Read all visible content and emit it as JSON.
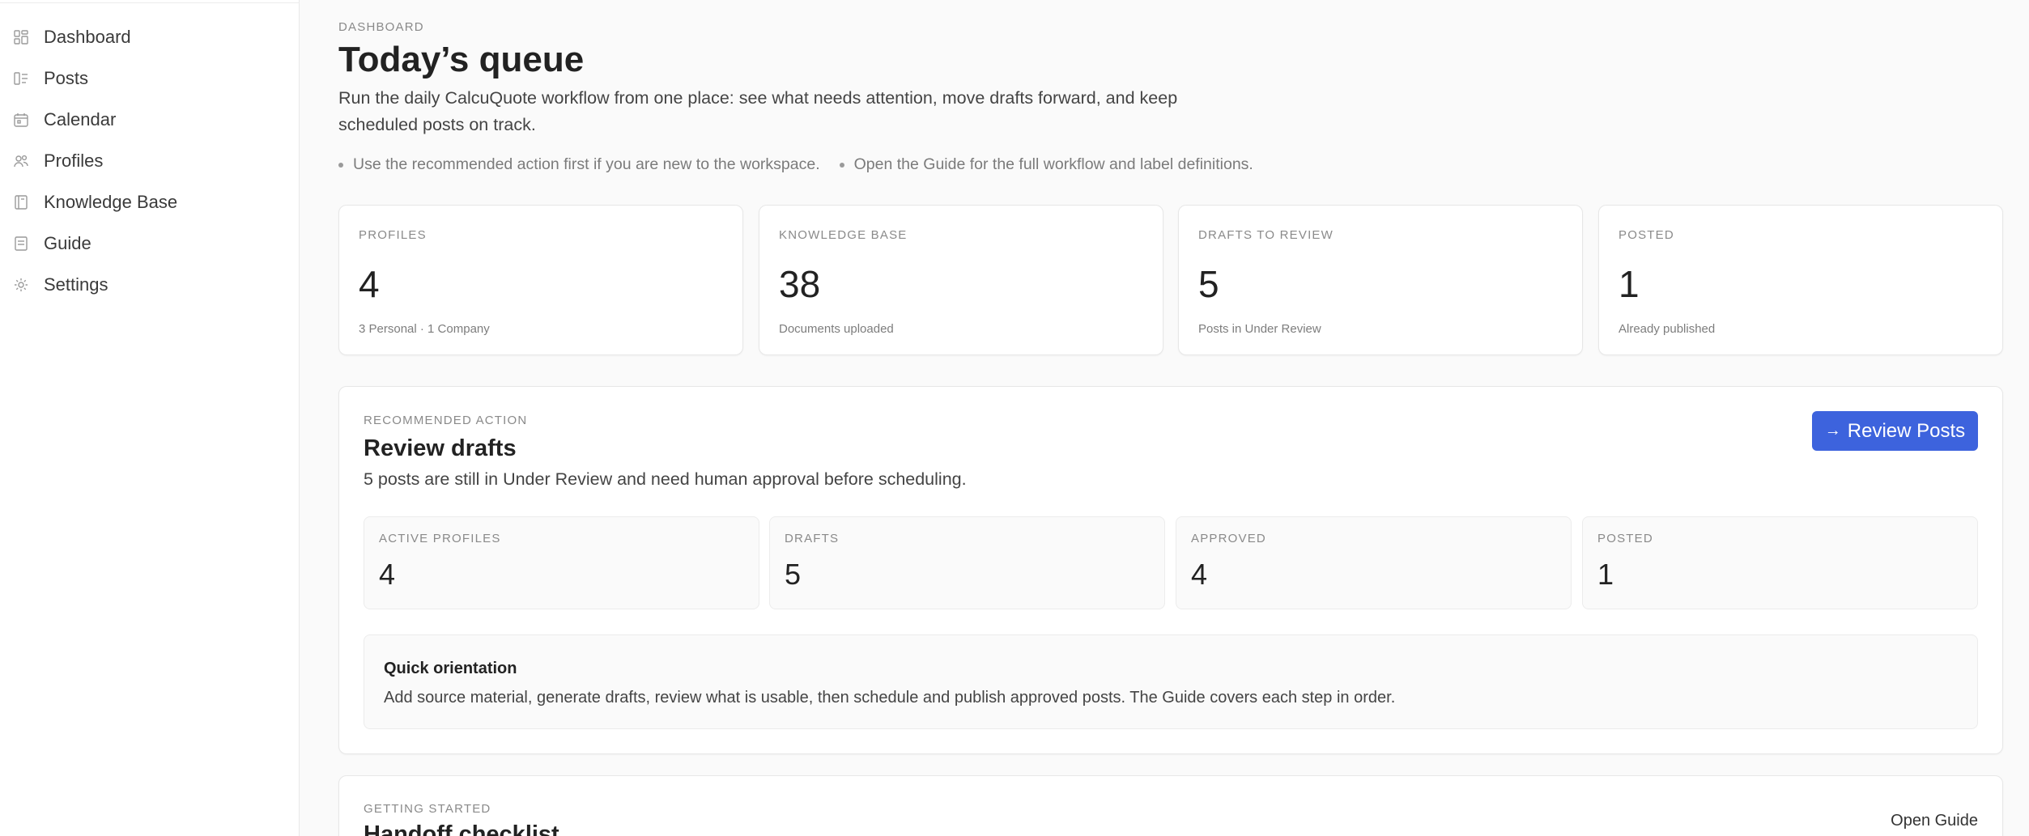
{
  "sidebar": {
    "items": [
      {
        "label": "Dashboard",
        "icon": "dashboard-icon"
      },
      {
        "label": "Posts",
        "icon": "posts-icon"
      },
      {
        "label": "Calendar",
        "icon": "calendar-icon"
      },
      {
        "label": "Profiles",
        "icon": "profiles-icon"
      },
      {
        "label": "Knowledge Base",
        "icon": "book-icon"
      },
      {
        "label": "Guide",
        "icon": "guide-icon"
      },
      {
        "label": "Settings",
        "icon": "gear-icon"
      }
    ]
  },
  "header": {
    "eyebrow": "DASHBOARD",
    "title": "Today’s queue",
    "description": "Run the daily CalcuQuote workflow from one place: see what needs attention, move drafts forward, and keep scheduled posts on track.",
    "tips": [
      "Use the recommended action first if you are new to the workspace.",
      "Open the Guide for the full workflow and label definitions."
    ]
  },
  "stats": [
    {
      "label": "PROFILES",
      "value": "4",
      "sub": "3 Personal · 1 Company"
    },
    {
      "label": "KNOWLEDGE BASE",
      "value": "38",
      "sub": "Documents uploaded"
    },
    {
      "label": "DRAFTS TO REVIEW",
      "value": "5",
      "sub": "Posts in Under Review"
    },
    {
      "label": "POSTED",
      "value": "1",
      "sub": "Already published"
    }
  ],
  "recommended": {
    "eyebrow": "RECOMMENDED ACTION",
    "title": "Review drafts",
    "description": "5 posts are still in Under Review and need human approval before scheduling.",
    "button_icon": "→",
    "button_label": "Review Posts",
    "metrics": [
      {
        "label": "ACTIVE PROFILES",
        "value": "4"
      },
      {
        "label": "DRAFTS",
        "value": "5"
      },
      {
        "label": "APPROVED",
        "value": "4"
      },
      {
        "label": "POSTED",
        "value": "1"
      }
    ],
    "orientation": {
      "title": "Quick orientation",
      "description": "Add source material, generate drafts, review what is usable, then schedule and publish approved posts. The Guide covers each step in order."
    }
  },
  "getting_started": {
    "eyebrow": "GETTING STARTED",
    "title": "Handoff checklist",
    "link_label": "Open Guide"
  },
  "colors": {
    "accent": "#3d63dd",
    "background": "#fafafa",
    "card": "#ffffff"
  }
}
